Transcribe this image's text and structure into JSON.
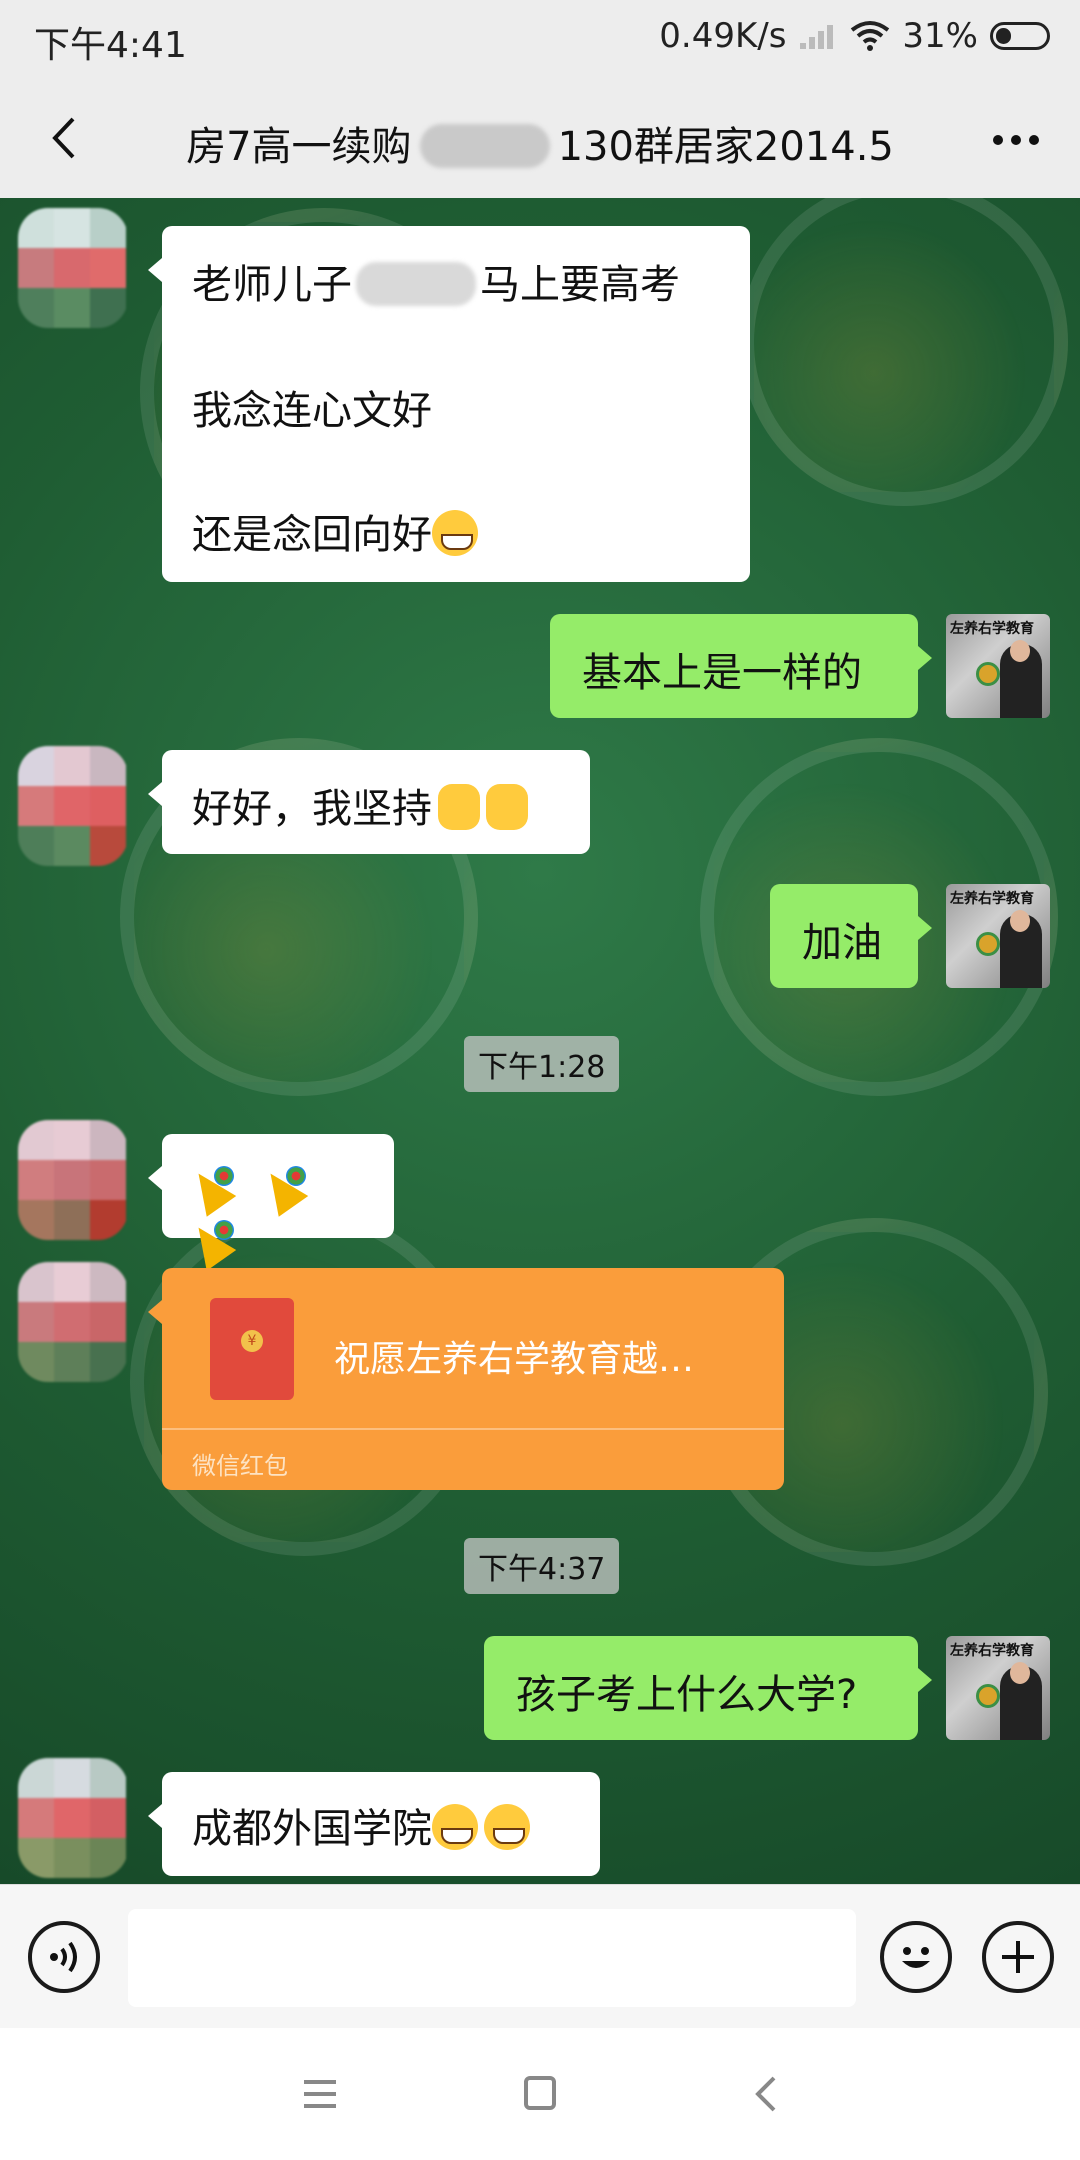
{
  "status_bar": {
    "time": "下午4:41",
    "network_speed": "0.49K/s",
    "battery": "31%",
    "battery_level": 0.31
  },
  "header": {
    "title_left": "房7高一续购",
    "title_right": "130群居家2014.5"
  },
  "messages": [
    {
      "side": "left",
      "type": "text",
      "lines": [
        "老师儿子",
        "马上要高考",
        "我念连心文好",
        "还是念回向好"
      ]
    },
    {
      "side": "right",
      "type": "text",
      "text": "基本上是一样的"
    },
    {
      "side": "left",
      "type": "text",
      "text": "好好，我坚持"
    },
    {
      "side": "right",
      "type": "text",
      "text": "加油"
    },
    {
      "type": "timestamp",
      "text": "下午1:28"
    },
    {
      "side": "left",
      "type": "emoji",
      "emoji": [
        "party-popper-icon",
        "party-popper-icon",
        "party-popper-icon"
      ]
    },
    {
      "side": "left",
      "type": "red_packet",
      "text": "祝愿左养右学教育越…",
      "label": "微信红包"
    },
    {
      "type": "timestamp",
      "text": "下午4:37"
    },
    {
      "side": "right",
      "type": "text",
      "text": "孩子考上什么大学?"
    },
    {
      "side": "left",
      "type": "text",
      "text": "成都外国学院"
    }
  ],
  "avatar_me_text": "左养右学教育",
  "colors": {
    "chat_bg": "#1f5d33",
    "bubble_self": "#95ec69",
    "bubble_other": "#ffffff",
    "red_packet": "#fa9d3b"
  },
  "input_bar": {
    "icons": [
      "voice-icon",
      "emoji-icon",
      "plus-icon"
    ]
  },
  "nav_bar": {
    "icons": [
      "menu-icon",
      "home-icon",
      "back-icon"
    ]
  }
}
